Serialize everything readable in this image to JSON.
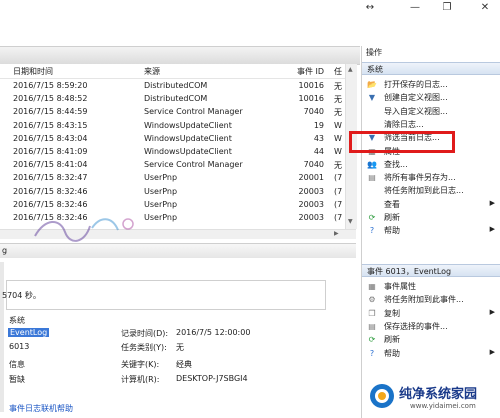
{
  "window": {
    "controls": [
      "↔",
      "—",
      "❐",
      "✕"
    ]
  },
  "table": {
    "headers": [
      "日期和时间",
      "来源",
      "事件 ID",
      "任"
    ],
    "rows": [
      {
        "date": "2016/7/15 8:59:20",
        "source": "DistributedCOM",
        "id": "10016",
        "task": "无"
      },
      {
        "date": "2016/7/15 8:48:52",
        "source": "DistributedCOM",
        "id": "10016",
        "task": "无"
      },
      {
        "date": "2016/7/15 8:44:59",
        "source": "Service Control Manager",
        "id": "7040",
        "task": "无"
      },
      {
        "date": "2016/7/15 8:43:15",
        "source": "WindowsUpdateClient",
        "id": "19",
        "task": "W"
      },
      {
        "date": "2016/7/15 8:43:04",
        "source": "WindowsUpdateClient",
        "id": "43",
        "task": "W"
      },
      {
        "date": "2016/7/15 8:41:09",
        "source": "WindowsUpdateClient",
        "id": "44",
        "task": "W"
      },
      {
        "date": "2016/7/15 8:41:04",
        "source": "Service Control Manager",
        "id": "7040",
        "task": "无"
      },
      {
        "date": "2016/7/15 8:32:47",
        "source": "UserPnp",
        "id": "20001",
        "task": "(7"
      },
      {
        "date": "2016/7/15 8:32:46",
        "source": "UserPnp",
        "id": "20003",
        "task": "(7"
      },
      {
        "date": "2016/7/15 8:32:46",
        "source": "UserPnp",
        "id": "20003",
        "task": "(7"
      },
      {
        "date": "2016/7/15 8:32:46",
        "source": "UserPnp",
        "id": "20003",
        "task": "(7"
      }
    ]
  },
  "detail": {
    "header": "g",
    "seconds_text": "5704 秒。",
    "labels": {
      "log": "系统",
      "source": "EventLog",
      "event_id": "6013",
      "level": "信息",
      "user": "暂缺",
      "recorded_label": "记录时间(D):",
      "recorded_value": "2016/7/5 12:00:00",
      "task_label": "任务类别(Y):",
      "task_value": "无",
      "keywords_label": "关键字(K):",
      "keywords_value": "经典",
      "computer_label": "计算机(R):",
      "computer_value": "DESKTOP-J7SBGI4",
      "help_link": "事件日志联机帮助"
    }
  },
  "actions": {
    "title": "操作",
    "section1": "系统",
    "items1": [
      {
        "icon": "folder-icon",
        "glyph": "📂",
        "label": "打开保存的日志...",
        "arrow": ""
      },
      {
        "icon": "filter-create-icon",
        "glyph": "▼",
        "label": "创建自定义视图...",
        "arrow": ""
      },
      {
        "icon": "blank-icon",
        "glyph": "",
        "label": "导入自定义视图...",
        "arrow": ""
      },
      {
        "icon": "blank-icon",
        "glyph": "",
        "label": "清除日志...",
        "arrow": ""
      },
      {
        "icon": "filter-icon",
        "glyph": "▼",
        "label": "筛选当前日志...",
        "arrow": ""
      },
      {
        "icon": "properties-icon",
        "glyph": "▦",
        "label": "属性",
        "arrow": ""
      },
      {
        "icon": "find-icon",
        "glyph": "👥",
        "label": "查找...",
        "arrow": ""
      },
      {
        "icon": "save-icon",
        "glyph": "▤",
        "label": "将所有事件另存为...",
        "arrow": ""
      },
      {
        "icon": "blank-icon",
        "glyph": "",
        "label": "将任务附加到此日志...",
        "arrow": ""
      },
      {
        "icon": "blank-icon",
        "glyph": "",
        "label": "查看",
        "arrow": "▶"
      },
      {
        "icon": "refresh-icon",
        "glyph": "⟳",
        "label": "刷新",
        "arrow": ""
      },
      {
        "icon": "help-icon",
        "glyph": "?",
        "label": "帮助",
        "arrow": "▶"
      }
    ],
    "section2": "事件 6013，EventLog",
    "items2": [
      {
        "icon": "event-props-icon",
        "glyph": "▦",
        "label": "事件属性",
        "arrow": ""
      },
      {
        "icon": "attach-task-icon",
        "glyph": "⚙",
        "label": "将任务附加到此事件...",
        "arrow": ""
      },
      {
        "icon": "copy-icon",
        "glyph": "❐",
        "label": "复制",
        "arrow": "▶"
      },
      {
        "icon": "save-selected-icon",
        "glyph": "▤",
        "label": "保存选择的事件...",
        "arrow": ""
      },
      {
        "icon": "refresh-icon",
        "glyph": "⟳",
        "label": "刷新",
        "arrow": ""
      },
      {
        "icon": "help-icon",
        "glyph": "?",
        "label": "帮助",
        "arrow": "▶"
      }
    ]
  },
  "watermark": {
    "site_name": "纯净系统家园",
    "site_url": "www.yidaimei.com"
  },
  "colors": {
    "highlight": "#e01b1b",
    "section_bg": "#d7e3f2",
    "selected_source_bg": "#3b78d8"
  }
}
